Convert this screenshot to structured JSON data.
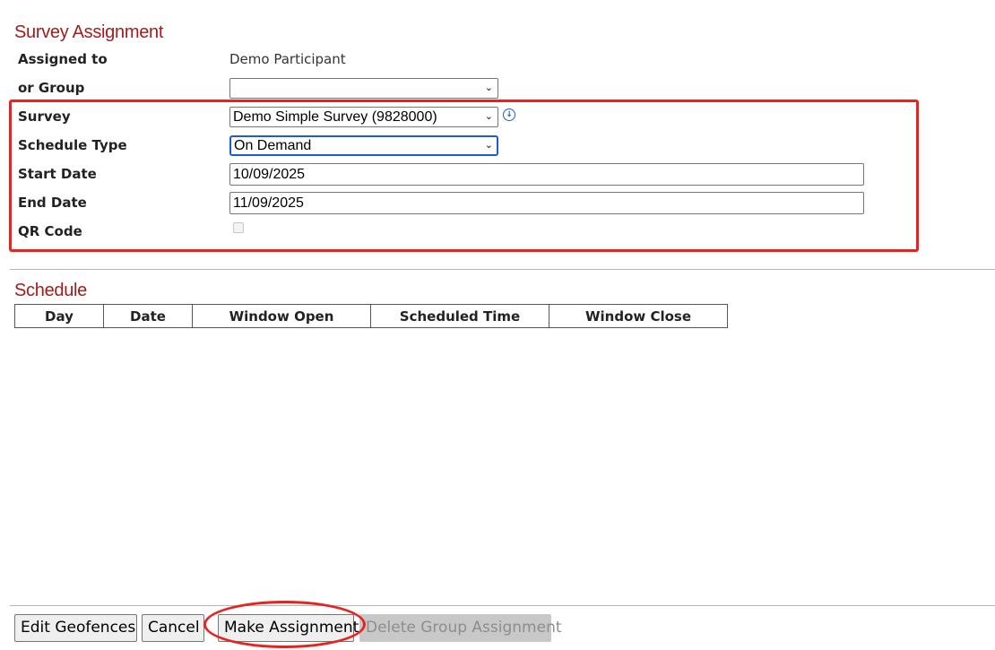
{
  "sections": {
    "survey_assignment_title": "Survey Assignment",
    "schedule_title": "Schedule"
  },
  "form": {
    "assigned_to": {
      "label": "Assigned to",
      "value": "Demo Participant"
    },
    "or_group": {
      "label": "or Group",
      "value": ""
    },
    "survey": {
      "label": "Survey",
      "value": "Demo Simple Survey (9828000)"
    },
    "schedule_type": {
      "label": "Schedule Type",
      "value": "On Demand"
    },
    "start_date": {
      "label": "Start Date",
      "value": "10/09/2025"
    },
    "end_date": {
      "label": "End Date",
      "value": "11/09/2025"
    },
    "qr_code": {
      "label": "QR Code",
      "checked": false,
      "disabled": true
    }
  },
  "schedule_table": {
    "headers": [
      "Day",
      "Date",
      "Window Open",
      "Scheduled Time",
      "Window Close"
    ],
    "rows": []
  },
  "buttons": {
    "edit_geofences": "Edit Geofences",
    "cancel": "Cancel",
    "make_assignment": "Make Assignment",
    "delete_group_assignment": "Delete Group Assignment"
  },
  "icons": {
    "survey_info": "info-download-icon",
    "select_arrow": "chevron-down-icon"
  },
  "colors": {
    "section_title": "#a11d1d",
    "annotation": "#e8231f",
    "focus": "#1c5bd6"
  }
}
